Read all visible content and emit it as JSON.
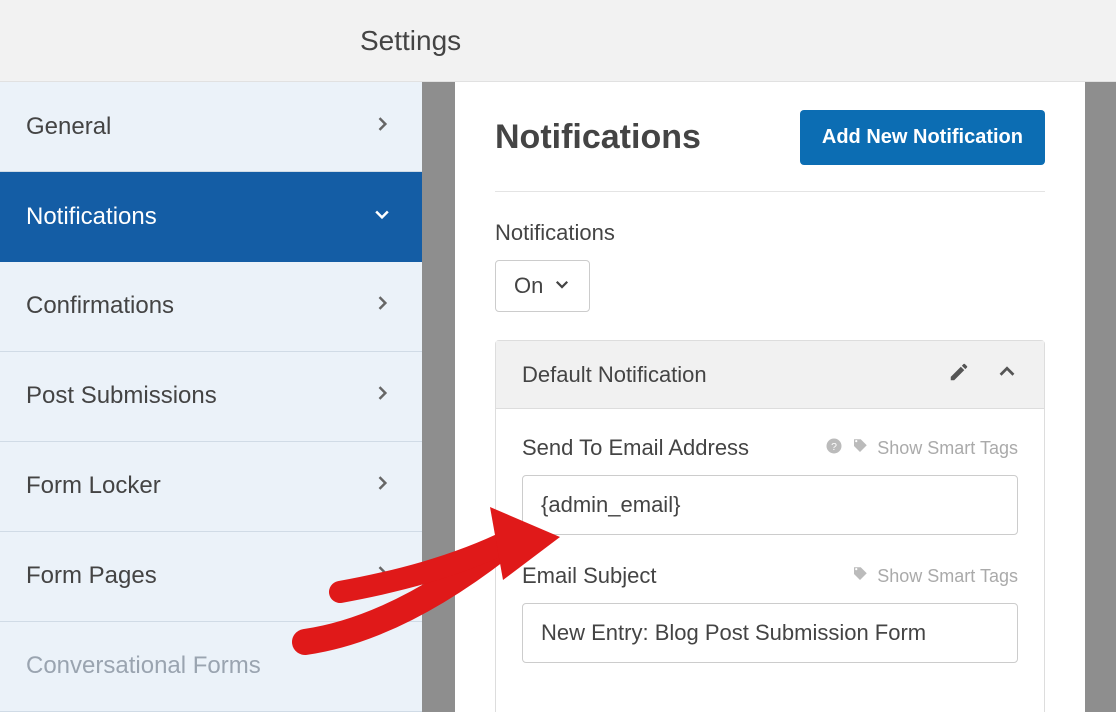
{
  "topbar": {
    "title": "Settings"
  },
  "sidebar": {
    "items": [
      {
        "label": "General"
      },
      {
        "label": "Notifications"
      },
      {
        "label": "Confirmations"
      },
      {
        "label": "Post Submissions"
      },
      {
        "label": "Form Locker"
      },
      {
        "label": "Form Pages"
      },
      {
        "label": "Conversational Forms"
      }
    ]
  },
  "content": {
    "heading": "Notifications",
    "add_button": "Add New Notification",
    "toggle_label": "Notifications",
    "toggle_value": "On",
    "panel": {
      "title": "Default Notification",
      "send_to_label": "Send To Email Address",
      "send_to_value": "{admin_email}",
      "subject_label": "Email Subject",
      "subject_value": "New Entry: Blog Post Submission Form",
      "smart_tags": "Show Smart Tags"
    }
  }
}
